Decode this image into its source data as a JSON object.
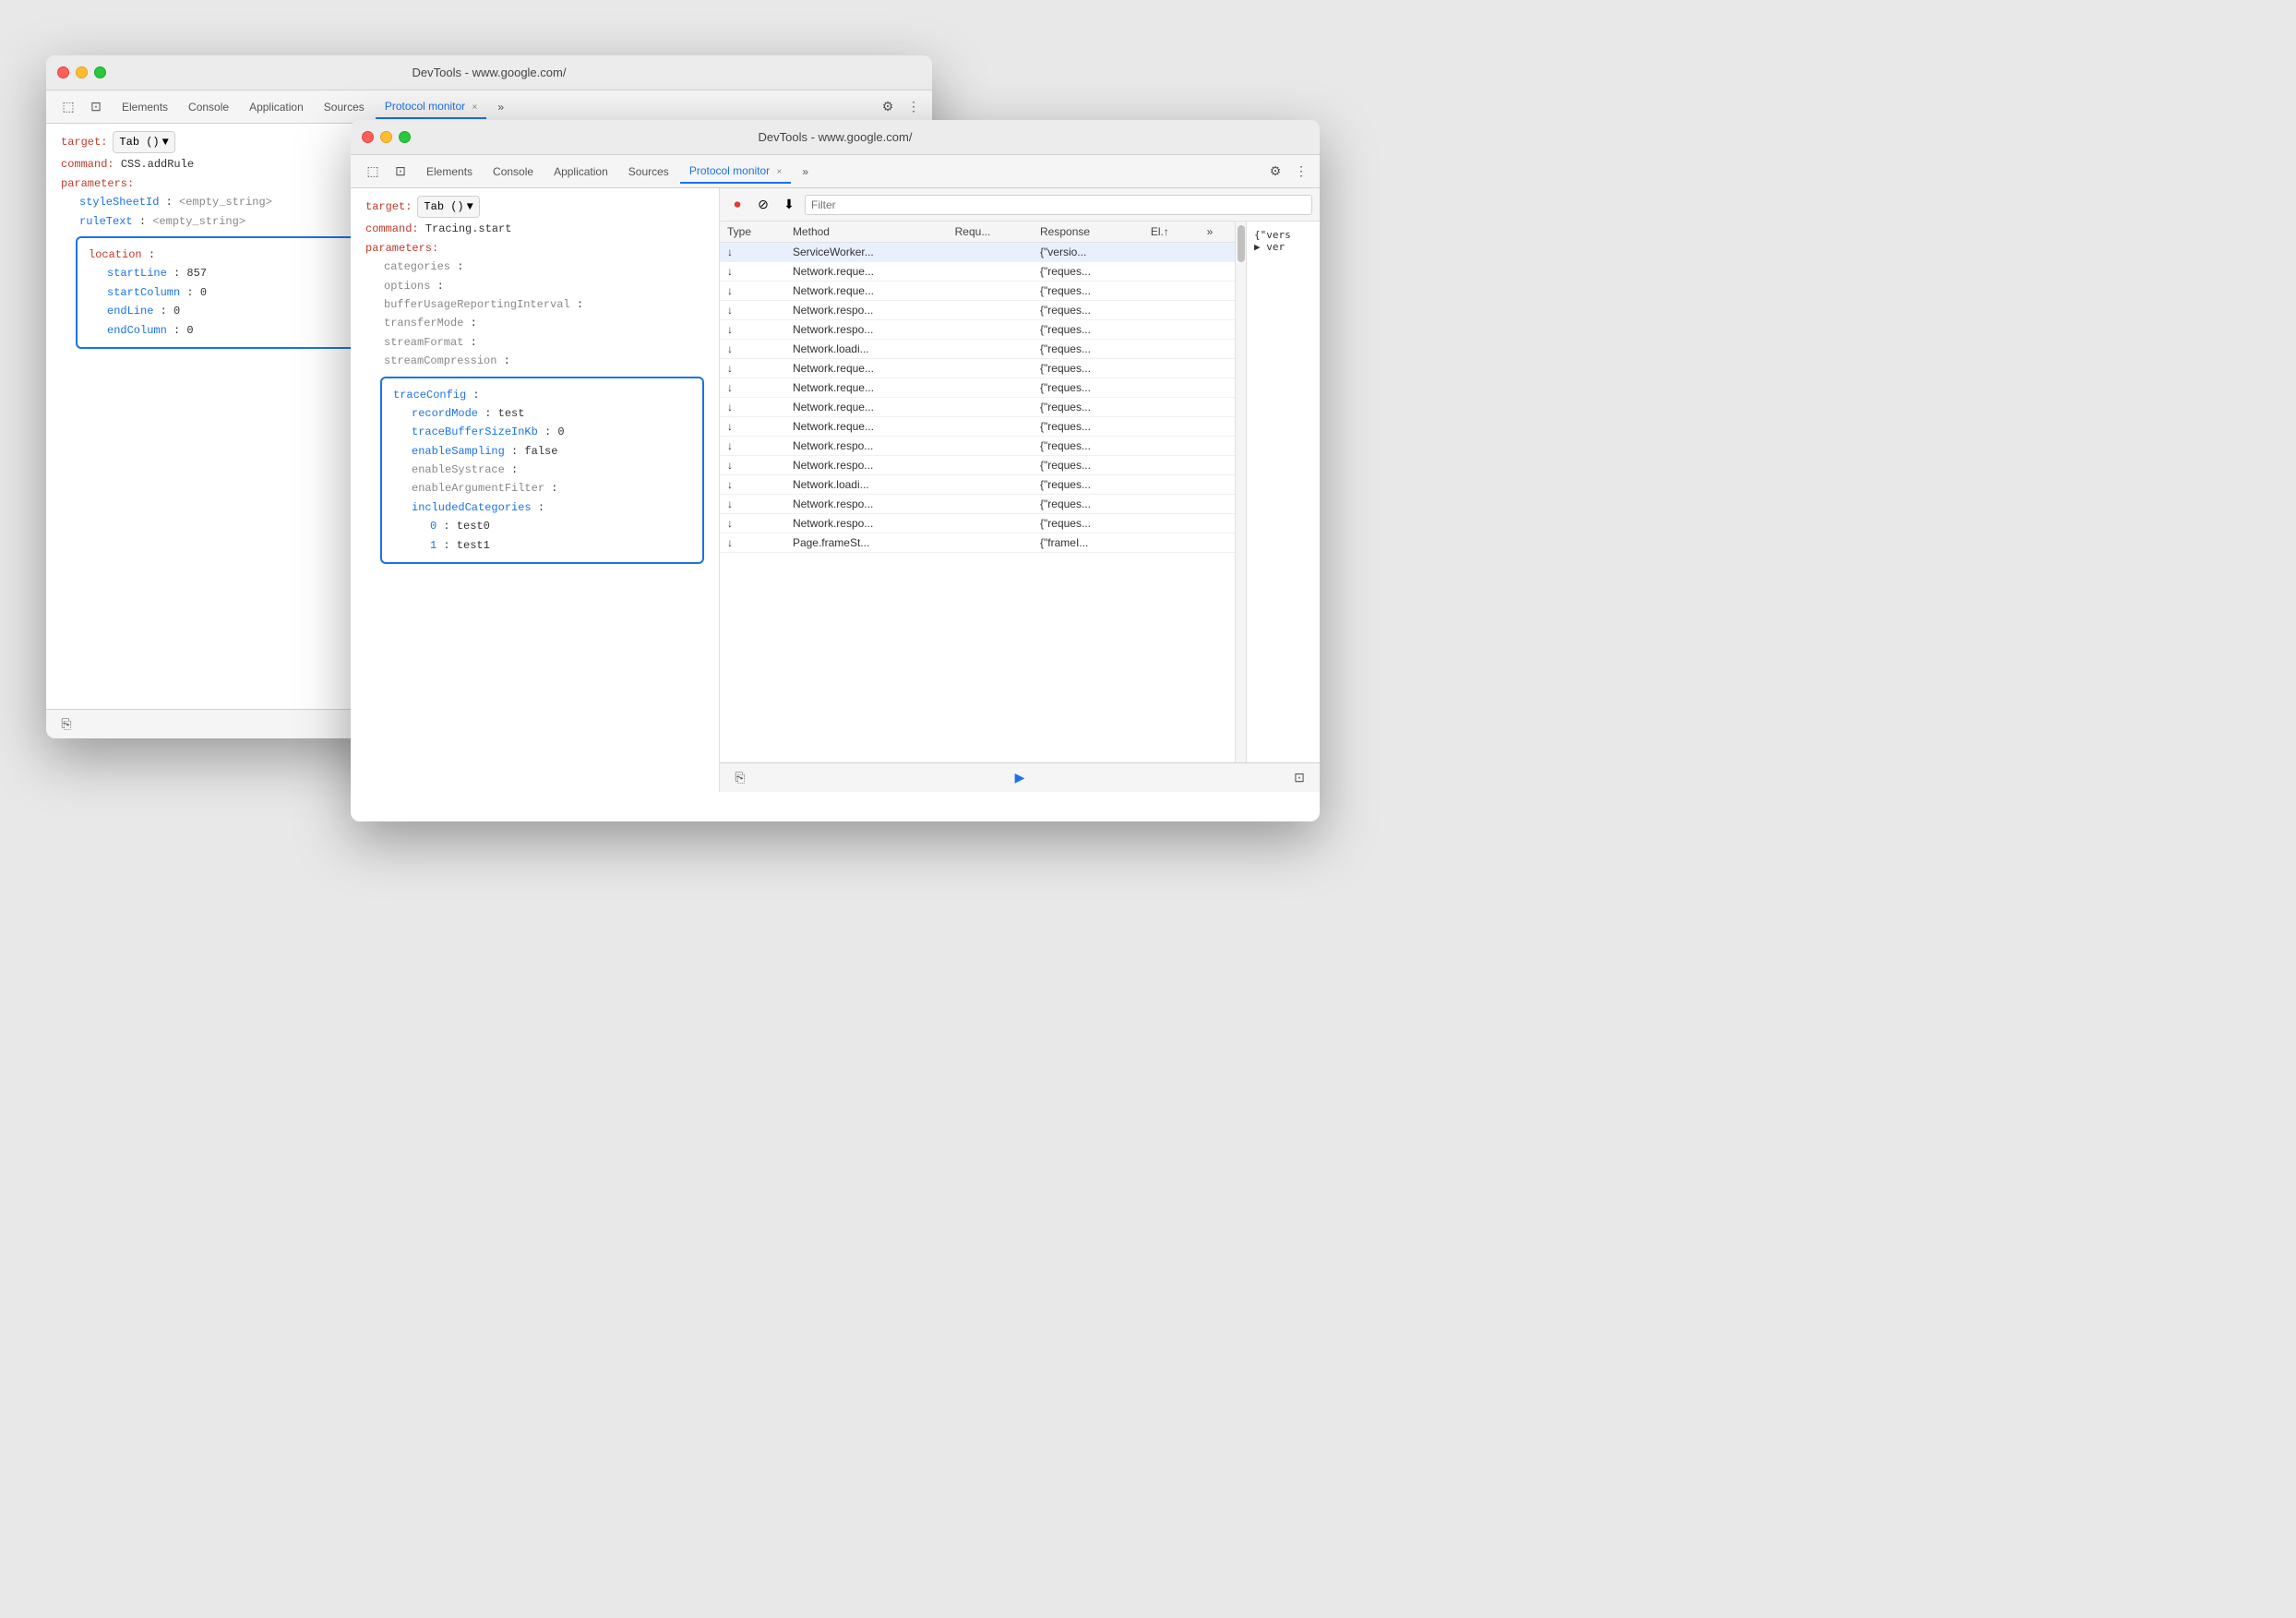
{
  "window_back": {
    "title": "DevTools - www.google.com/",
    "tabs": [
      {
        "label": "Elements",
        "active": false
      },
      {
        "label": "Console",
        "active": false
      },
      {
        "label": "Application",
        "active": false
      },
      {
        "label": "Sources",
        "active": false
      },
      {
        "label": "Protocol monitor",
        "active": true
      },
      {
        "label": "×",
        "is_close": true
      },
      {
        "label": "»",
        "is_more": true
      }
    ],
    "target_label": "target:",
    "target_value": "Tab ()",
    "command_label": "command:",
    "command_value": "CSS.addRule",
    "parameters_label": "parameters:",
    "fields": [
      {
        "indent": 1,
        "label": "styleSheetId",
        "colon": ":",
        "value": "<empty_string>"
      },
      {
        "indent": 1,
        "label": "ruleText",
        "colon": ":",
        "value": "<empty_string>"
      }
    ],
    "location_box": {
      "label": "location",
      "colon": ":",
      "fields": [
        {
          "label": "startLine",
          "colon": ":",
          "value": "857"
        },
        {
          "label": "startColumn",
          "colon": ":",
          "value": "0"
        },
        {
          "label": "endLine",
          "colon": ":",
          "value": "0"
        },
        {
          "label": "endColumn",
          "colon": ":",
          "value": "0"
        }
      ]
    },
    "bottom_icon": "⎘"
  },
  "window_front": {
    "title": "DevTools - www.google.com/",
    "tabs": [
      {
        "label": "Elements",
        "active": false
      },
      {
        "label": "Console",
        "active": false
      },
      {
        "label": "Application",
        "active": false
      },
      {
        "label": "Sources",
        "active": false
      },
      {
        "label": "Protocol monitor",
        "active": true
      },
      {
        "label": "×",
        "is_close": true
      },
      {
        "label": "»",
        "is_more": true
      }
    ],
    "target_label": "target:",
    "target_value": "Tab ()",
    "command_label": "command:",
    "command_value": "Tracing.start",
    "parameters_label": "parameters:",
    "fields": [
      {
        "indent": 1,
        "label": "categories",
        "colon": ":"
      },
      {
        "indent": 1,
        "label": "options",
        "colon": ":"
      },
      {
        "indent": 1,
        "label": "bufferUsageReportingInterval",
        "colon": ":"
      },
      {
        "indent": 1,
        "label": "transferMode",
        "colon": ":"
      },
      {
        "indent": 1,
        "label": "streamFormat",
        "colon": ":"
      },
      {
        "indent": 1,
        "label": "streamCompression",
        "colon": ":"
      }
    ],
    "trace_box": {
      "label": "traceConfig",
      "colon": ":",
      "fields": [
        {
          "label": "recordMode",
          "colon": ":",
          "value": "test"
        },
        {
          "label": "traceBufferSizeInKb",
          "colon": ":",
          "value": "0"
        },
        {
          "label": "enableSampling",
          "colon": ":",
          "value": "false"
        },
        {
          "label": "enableSystrace",
          "colon": ":"
        },
        {
          "label": "enableArgumentFilter",
          "colon": ":"
        },
        {
          "label": "includedCategories",
          "colon": ":",
          "sub": [
            {
              "index": "0",
              "value": "test0"
            },
            {
              "index": "1",
              "value": "test1"
            }
          ]
        }
      ]
    },
    "network_toolbar": {
      "record_icon": "⏺",
      "clear_icon": "⊘",
      "download_icon": "⬇",
      "filter_placeholder": "Filter"
    },
    "network_table": {
      "columns": [
        "Type",
        "Method",
        "Requ...",
        "Response",
        "El.↑",
        ""
      ],
      "rows": [
        {
          "type": "↓",
          "method": "ServiceWorker...",
          "request": "",
          "response": "{\"versio...",
          "elapsed": "",
          "selected": true
        },
        {
          "type": "↓",
          "method": "Network.reque...",
          "request": "",
          "response": "{\"reques...",
          "elapsed": ""
        },
        {
          "type": "↓",
          "method": "Network.reque...",
          "request": "",
          "response": "{\"reques...",
          "elapsed": ""
        },
        {
          "type": "↓",
          "method": "Network.respo...",
          "request": "",
          "response": "{\"reques...",
          "elapsed": ""
        },
        {
          "type": "↓",
          "method": "Network.respo...",
          "request": "",
          "response": "{\"reques...",
          "elapsed": ""
        },
        {
          "type": "↓",
          "method": "Network.loadi...",
          "request": "",
          "response": "{\"reques...",
          "elapsed": ""
        },
        {
          "type": "↓",
          "method": "Network.reque...",
          "request": "",
          "response": "{\"reques...",
          "elapsed": ""
        },
        {
          "type": "↓",
          "method": "Network.reque...",
          "request": "",
          "response": "{\"reques...",
          "elapsed": ""
        },
        {
          "type": "↓",
          "method": "Network.reque...",
          "request": "",
          "response": "{\"reques...",
          "elapsed": ""
        },
        {
          "type": "↓",
          "method": "Network.reque...",
          "request": "",
          "response": "{\"reques...",
          "elapsed": ""
        },
        {
          "type": "↓",
          "method": "Network.respo...",
          "request": "",
          "response": "{\"reques...",
          "elapsed": ""
        },
        {
          "type": "↓",
          "method": "Network.respo...",
          "request": "",
          "response": "{\"reques...",
          "elapsed": ""
        },
        {
          "type": "↓",
          "method": "Network.loadi...",
          "request": "",
          "response": "{\"reques...",
          "elapsed": ""
        },
        {
          "type": "↓",
          "method": "Network.respo...",
          "request": "",
          "response": "{\"reques...",
          "elapsed": ""
        },
        {
          "type": "↓",
          "method": "Network.respo...",
          "request": "",
          "response": "{\"reques...",
          "elapsed": ""
        },
        {
          "type": "↓",
          "method": "Page.frameSt...",
          "request": "",
          "response": "{\"frameI...",
          "elapsed": ""
        }
      ]
    },
    "json_preview": {
      "line1": "{\"vers",
      "line2": "▶ ver"
    },
    "bottom_left_icon": "⎘",
    "bottom_center_icon": "▶",
    "bottom_right_icon": "⊡"
  }
}
